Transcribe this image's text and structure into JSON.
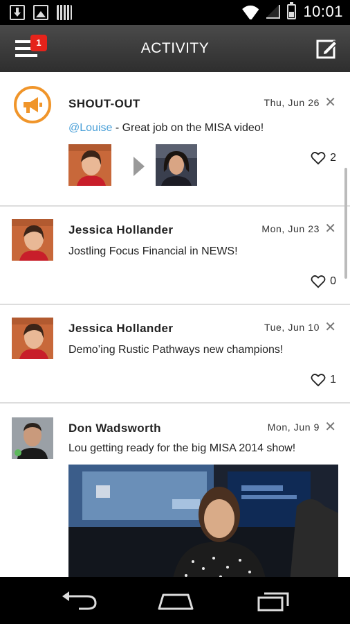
{
  "status_bar": {
    "time": "10:01"
  },
  "app_bar": {
    "title": "ACTIVITY",
    "menu_badge": "1"
  },
  "feed": [
    {
      "type": "shout-out",
      "name": "SHOUT-OUT",
      "date": "Thu, Jun 26",
      "mention": "@Louise",
      "message": " - Great job on the MISA video!",
      "likes": "2"
    },
    {
      "name": "Jessica Hollander",
      "date": "Mon, Jun 23",
      "message": "Jostling Focus Financial in NEWS!",
      "likes": "0"
    },
    {
      "name": "Jessica Hollander",
      "date": "Tue, Jun 10",
      "message": "Demo’ing Rustic Pathways new champions!",
      "likes": "1"
    },
    {
      "name": "Don Wadsworth",
      "date": "Mon, Jun 9",
      "message": "Lou getting ready for the big MISA 2014 show!"
    }
  ],
  "colors": {
    "accent_orange": "#f0952a",
    "mention_blue": "#4aa0d8",
    "badge_red": "#e5231b"
  }
}
